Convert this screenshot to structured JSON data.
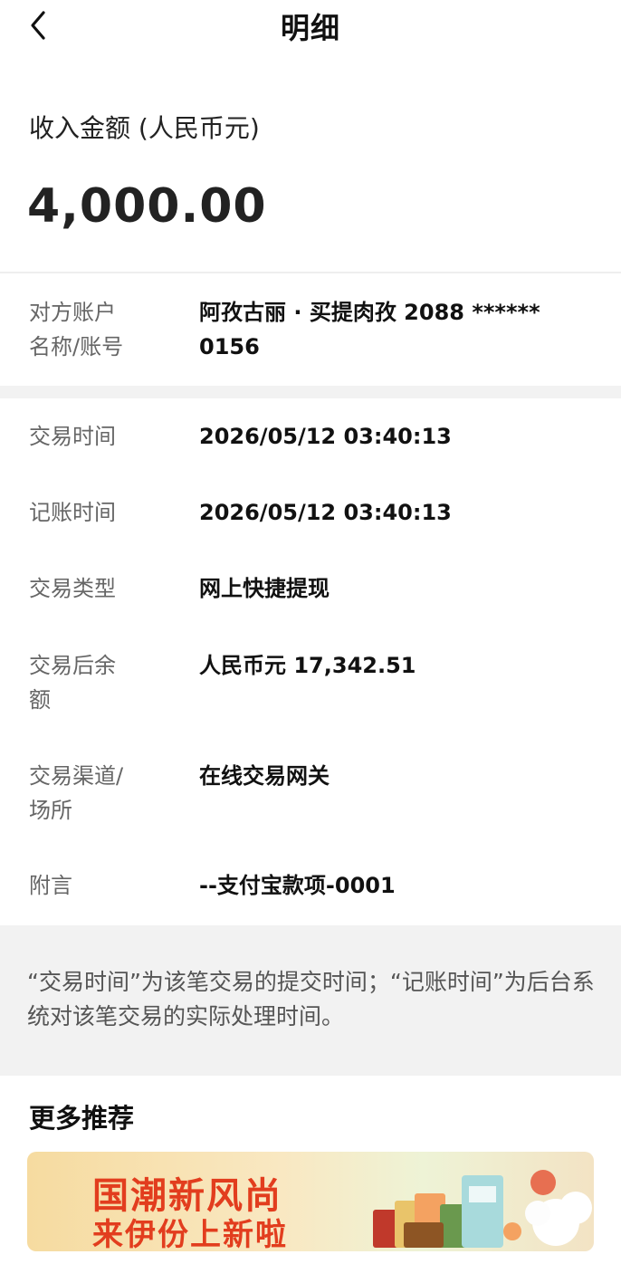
{
  "header": {
    "title": "明细"
  },
  "summary": {
    "amount_label": "收入金额 (人民币元)",
    "amount": "4,000.00"
  },
  "counterparty": {
    "label_line1": "对方账户",
    "label_line2": "名称/账号",
    "value_line1": "阿孜古丽 · 买提肉孜 2088 ******",
    "value_line2": "0156"
  },
  "details": [
    {
      "label": "交易时间",
      "value": "2026/05/12 03:40:13"
    },
    {
      "label": "记账时间",
      "value": "2026/05/12 03:40:13"
    },
    {
      "label": "交易类型",
      "value": "网上快捷提现"
    },
    {
      "label_line1": "交易后余",
      "label_line2": "额",
      "value": "人民币元 17,342.51"
    },
    {
      "label_line1": "交易渠道/",
      "label_line2": "场所",
      "value": "在线交易网关"
    },
    {
      "label": "附言",
      "value": "--支付宝款项-0001"
    }
  ],
  "note": "“交易时间”为该笔交易的提交时间；“记账时间”为后台系统对该笔交易的实际处理时间。",
  "recommend": {
    "title": "更多推荐",
    "banner_line1": "国潮新风尚",
    "banner_line2": "来伊份上新啦"
  },
  "colors": {
    "banner_text": "#e23d1e",
    "page_bg": "#f2f2f2"
  }
}
